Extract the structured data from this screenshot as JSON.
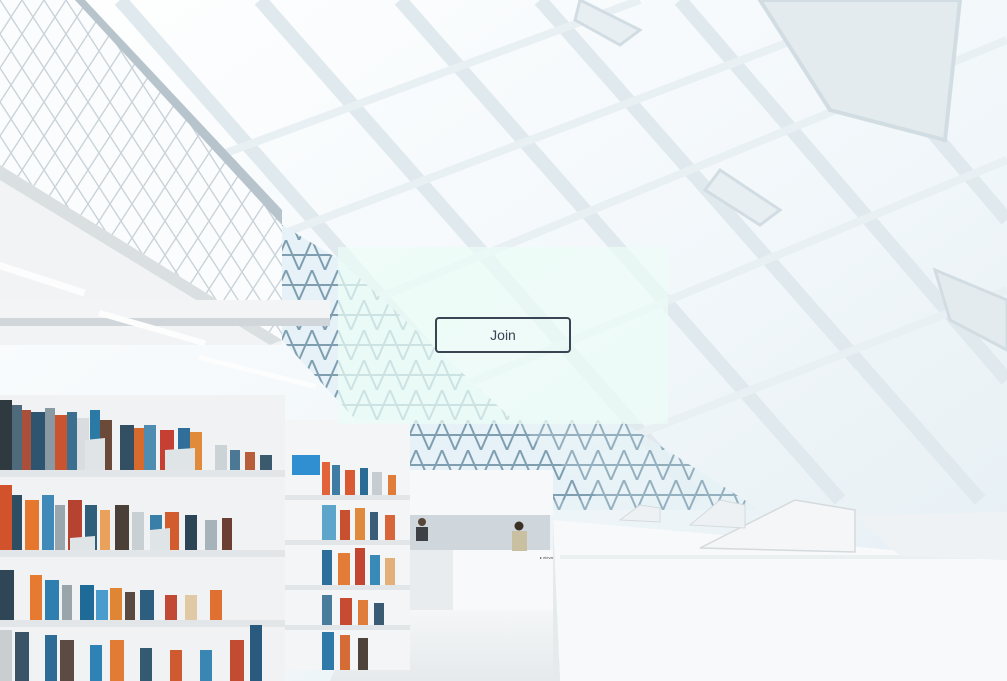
{
  "join_card": {
    "join_label": "Join"
  },
  "background": {
    "subject": "library-interior-photo",
    "sign_text": "elevators"
  },
  "colors": {
    "panel_tint": "#ecfcf7",
    "button_border": "#3b4452",
    "button_text": "#3b4452"
  }
}
